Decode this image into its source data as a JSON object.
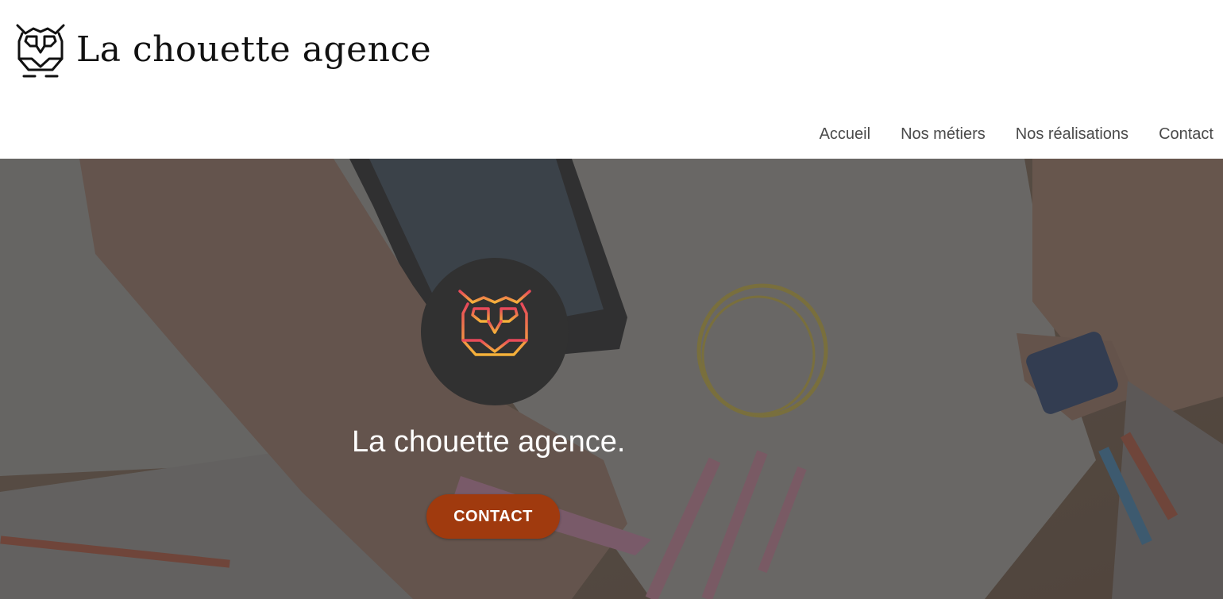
{
  "header": {
    "brand_name": "La chouette agence",
    "logo_icon": "owl-icon"
  },
  "nav": {
    "items": [
      {
        "label": "Accueil"
      },
      {
        "label": "Nos métiers"
      },
      {
        "label": "Nos réalisations"
      },
      {
        "label": "Contact"
      }
    ]
  },
  "hero": {
    "badge_icon": "owl-icon",
    "title": "La chouette agence.",
    "button_label": "CONTACT",
    "colors": {
      "button": "#a03a0e",
      "badge": "#313131",
      "owl_gradient_top": "#e8485a",
      "owl_gradient_bottom": "#f5b23a"
    }
  }
}
